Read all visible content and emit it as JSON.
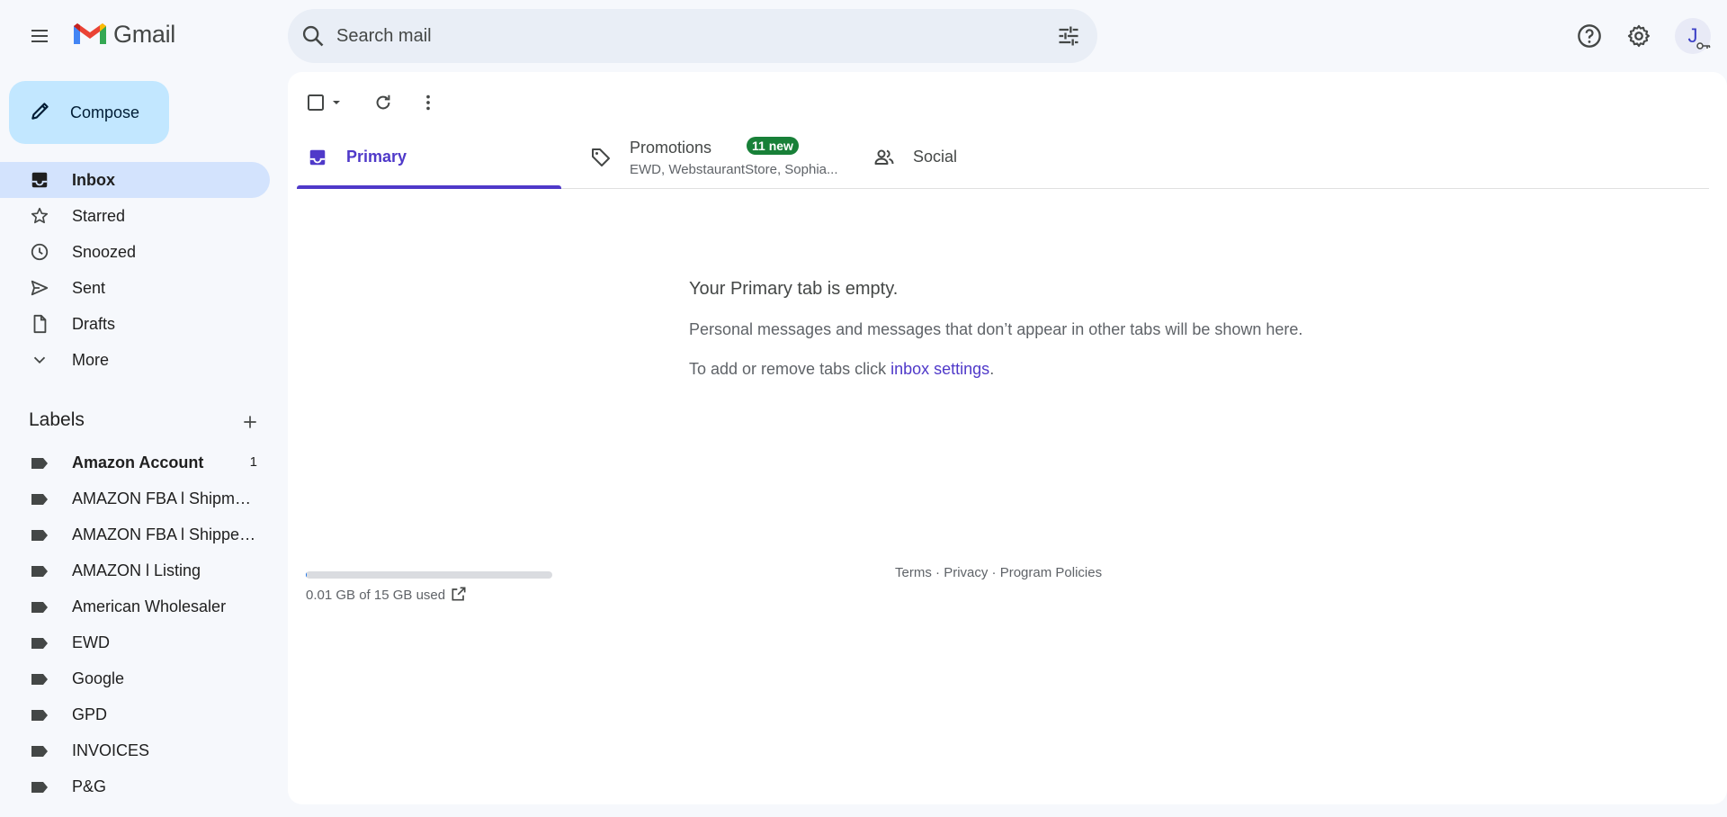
{
  "app": {
    "name": "Gmail"
  },
  "search": {
    "placeholder": "Search mail"
  },
  "header": {
    "avatar_initial": "J"
  },
  "sidebar": {
    "compose_label": "Compose",
    "nav": [
      {
        "label": "Inbox",
        "icon": "inbox-icon",
        "active": true
      },
      {
        "label": "Starred",
        "icon": "star-icon"
      },
      {
        "label": "Snoozed",
        "icon": "clock-icon"
      },
      {
        "label": "Sent",
        "icon": "send-icon"
      },
      {
        "label": "Drafts",
        "icon": "draft-icon"
      },
      {
        "label": "More",
        "icon": "chevron-down-icon"
      }
    ],
    "labels_heading": "Labels",
    "labels": [
      {
        "name": "Amazon Account",
        "count": "1",
        "bold": true
      },
      {
        "name": "AMAZON FBA l Shipmen..."
      },
      {
        "name": "AMAZON FBA l Shipped ..."
      },
      {
        "name": "AMAZON l Listing"
      },
      {
        "name": "American Wholesaler"
      },
      {
        "name": "EWD"
      },
      {
        "name": "Google"
      },
      {
        "name": "GPD"
      },
      {
        "name": "INVOICES"
      },
      {
        "name": "P&G"
      }
    ]
  },
  "tabs": [
    {
      "label": "Primary",
      "icon": "inbox-tab-icon",
      "active": true
    },
    {
      "label": "Promotions",
      "icon": "tag-icon",
      "badge": "11 new",
      "subtitle": "EWD, WebstaurantStore, Sophia..."
    },
    {
      "label": "Social",
      "icon": "people-icon"
    }
  ],
  "empty_state": {
    "title": "Your Primary tab is empty.",
    "description": "Personal messages and messages that don’t appear in other tabs will be shown here.",
    "tip_prefix": "To add or remove tabs click ",
    "tip_link": "inbox settings",
    "tip_suffix": "."
  },
  "footer": {
    "storage_text": "0.01 GB of 15 GB used",
    "storage_used_fraction": 0.0007,
    "terms": "Terms",
    "privacy": "Privacy",
    "policies": "Program Policies",
    "separator": " · "
  },
  "colors": {
    "accent": "#4f39c9",
    "compose_bg": "#c2e7ff",
    "active_nav_bg": "#d3e3fd",
    "badge_bg": "#188038"
  }
}
